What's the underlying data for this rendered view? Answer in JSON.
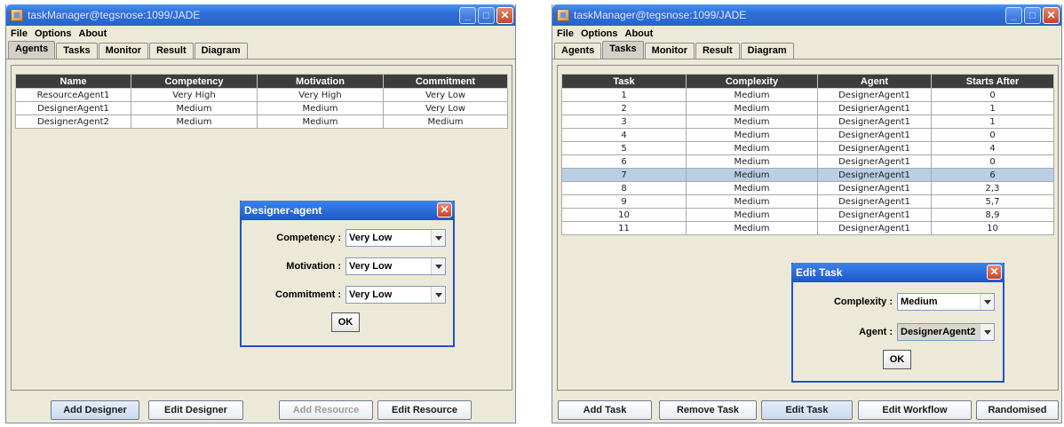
{
  "colors": {
    "titlebar": "#2f6fd9",
    "table_header": "#3d3d3d",
    "selected_row": "#b8cfe5",
    "window_bg": "#ece9d8"
  },
  "left": {
    "title": "taskManager@tegsnose:1099/JADE",
    "menu": [
      "File",
      "Options",
      "About"
    ],
    "tabs": [
      "Agents",
      "Tasks",
      "Monitor",
      "Result",
      "Diagram"
    ],
    "active_tab": "Agents",
    "table": {
      "headers": [
        "Name",
        "Competency",
        "Motivation",
        "Commitment"
      ],
      "rows": [
        [
          "ResourceAgent1",
          "Very High",
          "Very High",
          "Very Low"
        ],
        [
          "DesignerAgent1",
          "Medium",
          "Medium",
          "Very Low"
        ],
        [
          "DesignerAgent2",
          "Medium",
          "Medium",
          "Medium"
        ]
      ]
    },
    "dialog": {
      "title": "Designer-agent",
      "competency_label": "Competency :",
      "competency_value": "Very Low",
      "motivation_label": "Motivation :",
      "motivation_value": "Very Low",
      "commitment_label": "Commitment :",
      "commitment_value": "Very Low",
      "ok": "OK"
    },
    "buttons": [
      "Add Designer",
      "Edit Designer",
      "Add Resource",
      "Edit Resource"
    ]
  },
  "right": {
    "title": "taskManager@tegsnose:1099/JADE",
    "menu": [
      "File",
      "Options",
      "About"
    ],
    "tabs": [
      "Agents",
      "Tasks",
      "Monitor",
      "Result",
      "Diagram"
    ],
    "active_tab": "Tasks",
    "table": {
      "headers": [
        "Task",
        "Complexity",
        "Agent",
        "Starts After"
      ],
      "rows": [
        [
          "1",
          "Medium",
          "DesignerAgent1",
          "0"
        ],
        [
          "2",
          "Medium",
          "DesignerAgent1",
          "1"
        ],
        [
          "3",
          "Medium",
          "DesignerAgent1",
          "1"
        ],
        [
          "4",
          "Medium",
          "DesignerAgent1",
          "0"
        ],
        [
          "5",
          "Medium",
          "DesignerAgent1",
          "4"
        ],
        [
          "6",
          "Medium",
          "DesignerAgent1",
          "0"
        ],
        [
          "7",
          "Medium",
          "DesignerAgent1",
          "6"
        ],
        [
          "8",
          "Medium",
          "DesignerAgent1",
          "2,3"
        ],
        [
          "9",
          "Medium",
          "DesignerAgent1",
          "5,7"
        ],
        [
          "10",
          "Medium",
          "DesignerAgent1",
          "8,9"
        ],
        [
          "11",
          "Medium",
          "DesignerAgent1",
          "10"
        ]
      ],
      "selected_row": 6
    },
    "dialog": {
      "title": "Edit Task",
      "complexity_label": "Complexity :",
      "complexity_value": "Medium",
      "agent_label": "Agent :",
      "agent_value": "DesignerAgent2",
      "ok": "OK"
    },
    "buttons": [
      "Add Task",
      "Remove Task",
      "Edit Task",
      "Edit Workflow",
      "Randomised"
    ]
  }
}
